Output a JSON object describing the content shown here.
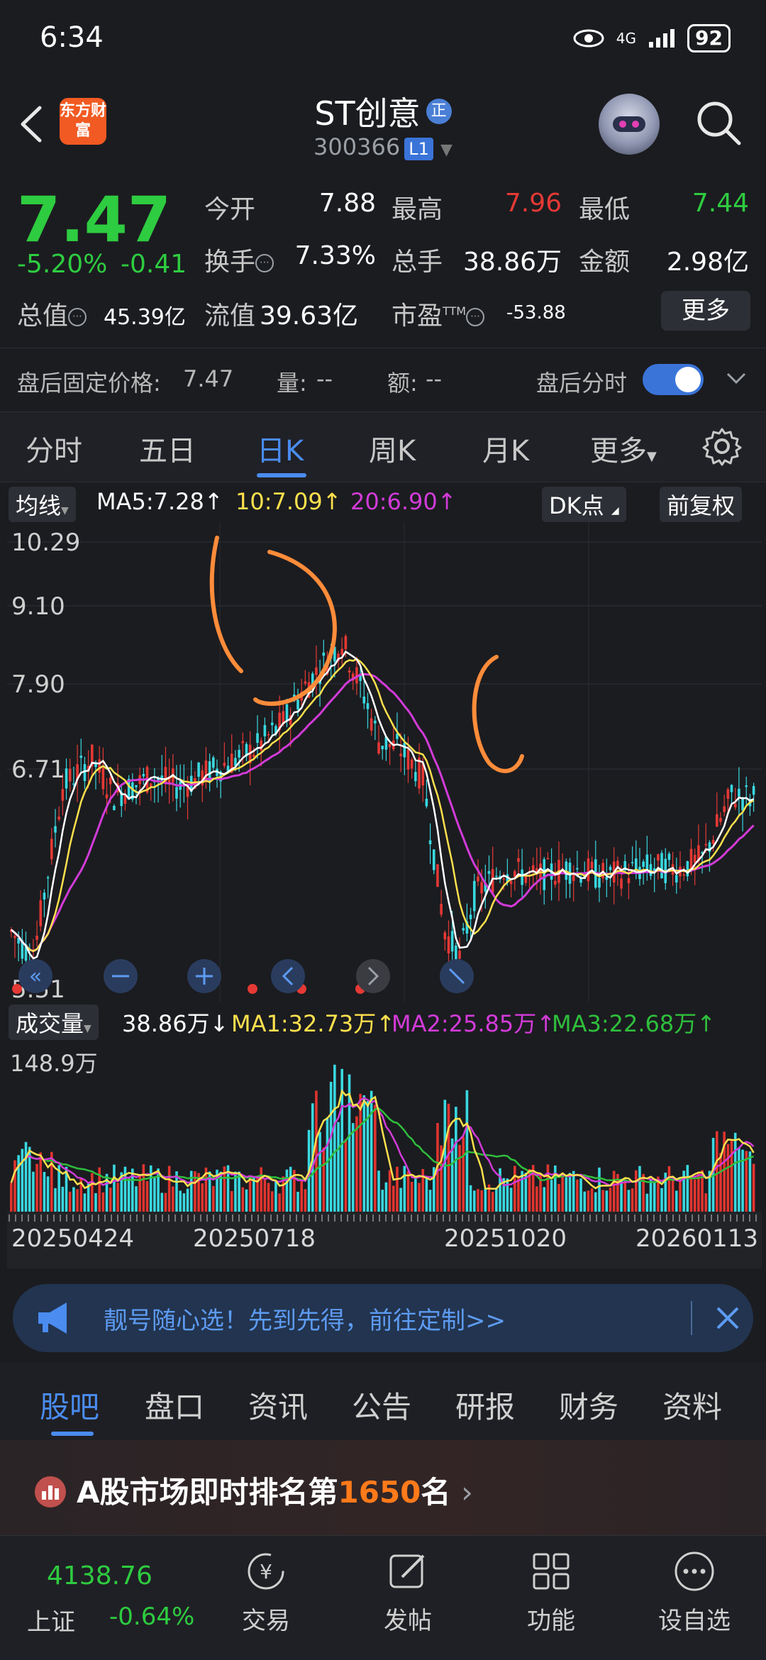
{
  "status": {
    "time": "6:34",
    "network": "4G",
    "battery": "92"
  },
  "header": {
    "stock_name": "ST创意",
    "badge": "正",
    "stock_code": "300366",
    "level_badge": "L1",
    "app_logo": "东方财富"
  },
  "quote": {
    "last_price": "7.47",
    "pct_change": "-5.20%",
    "amt_change": "-0.41",
    "open_label": "今开",
    "open": "7.88",
    "high_label": "最高",
    "high": "7.96",
    "low_label": "最低",
    "low": "7.44",
    "turnover_label": "换手",
    "turnover": "7.33%",
    "volume_label": "总手",
    "volume": "38.86万",
    "amount_label": "金额",
    "amount": "2.98亿",
    "mktcap_label": "总值",
    "mktcap": "45.39亿",
    "float_label": "流值",
    "float_cap": "39.63亿",
    "pe_label": "市盈",
    "pe_sup": "TTM",
    "pe": "-53.88",
    "more_label": "更多"
  },
  "after_hours": {
    "price_label": "盘后固定价格:",
    "price": "7.47",
    "vol_label": "量:",
    "vol": "--",
    "amt_label": "额:",
    "amt": "--",
    "toggle_label": "盘后分时"
  },
  "period_tabs": [
    "分时",
    "五日",
    "日K",
    "周K",
    "月K",
    "更多"
  ],
  "active_period": "日K",
  "ma_legend": {
    "chip": "均线",
    "ma5": "MA5:7.28",
    "ma10": "10:7.09",
    "ma20": "20:6.90",
    "dk_label": "DK点",
    "adjust_label": "前复权"
  },
  "price_axis": [
    "10.29",
    "9.10",
    "7.90",
    "6.71",
    "5.51"
  ],
  "vol_legend": {
    "chip": "成交量",
    "vol": "38.86万",
    "ma1": "MA1:32.73万",
    "ma2": "MA2:25.85万",
    "ma3": "MA3:22.68万",
    "axis_max": "148.9万"
  },
  "dates": [
    "20250424",
    "20250718",
    "20251020",
    "20260113"
  ],
  "colors": {
    "up": "#e53935",
    "down": "#2ecc40",
    "ma5": "#ffffff",
    "ma10": "#ffe14d",
    "ma20": "#d23bd8",
    "vol_up": "#e0352f",
    "vol_down": "#39d8e0",
    "accent": "#4a8cf0",
    "annotation": "#ff8c3a"
  },
  "promo": {
    "text": "靓号随心选！先到先得，前往定制>>"
  },
  "section_tabs": [
    "股吧",
    "盘口",
    "资讯",
    "公告",
    "研报",
    "财务",
    "资料"
  ],
  "active_section": "股吧",
  "rank": {
    "prefix": "A股市场即时排名第",
    "number": "1650",
    "suffix": "名"
  },
  "bottom_nav": {
    "index_value": "4138.76",
    "index_name": "上证",
    "index_change": "-0.64%",
    "items": [
      "交易",
      "发帖",
      "功能",
      "设自选"
    ]
  }
}
